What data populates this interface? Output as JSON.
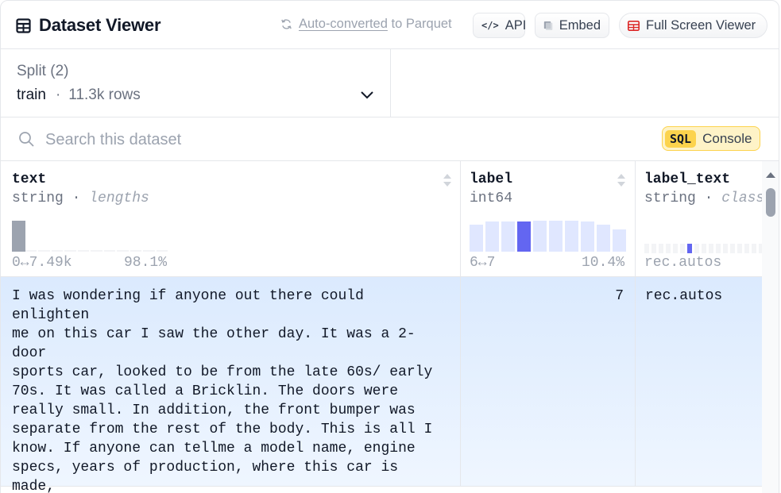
{
  "header": {
    "title": "Dataset Viewer",
    "parquet_link": "Auto-converted",
    "parquet_suffix": "to Parquet",
    "api_label": "API",
    "api_icon_glyph": "</>",
    "embed_label": "Embed",
    "full_screen_label": "Full Screen Viewer"
  },
  "split": {
    "label": "Split (2)",
    "value": "train",
    "separator": "·",
    "rows": "11.3k rows"
  },
  "search": {
    "placeholder": "Search this dataset",
    "sql_tag": "SQL",
    "sql_label": "Console"
  },
  "columns": [
    {
      "name": "text",
      "type": "string",
      "stat": "lengths",
      "range_left": "0↔7.49k",
      "range_right": "98.1%",
      "histogram_share": [
        0.98,
        0.01,
        0.005,
        0.003,
        0.002
      ]
    },
    {
      "name": "label",
      "type": "int64",
      "range_left": "6↔7",
      "range_right": "10.4%",
      "highlight_index": 3
    },
    {
      "name": "label_text",
      "type": "string",
      "stat": "classes",
      "range_left": "rec.autos"
    }
  ],
  "rows": [
    {
      "text": "I was wondering if anyone out there could enlighten\nme on this car I saw the other day. It was a 2-door\nsports car, looked to be from the late 60s/ early\n70s. It was called a Bricklin. The doors were\nreally small. In addition, the front bumper was\nseparate from the rest of the body. This is all I\nknow. If anyone can tellme a model name, engine\nspecs, years of production, where this car is made,\nhistory, or whatever info you have on this funky\nlooking car, please e-mail.",
      "label": "7",
      "label_text": "rec.autos"
    }
  ],
  "colors": {
    "accent": "#6366f1",
    "bar_light": "#e0e7ff",
    "bar_gray": "#9ca3af",
    "row_highlight": "#dbeafe",
    "sql_bg": "#fef3c7",
    "sql_tag": "#fcd34d"
  },
  "icons": {
    "title": "table-grid-icon",
    "parquet": "refresh-icon",
    "api": "code-icon",
    "embed": "embed-icon",
    "full_screen": "full-screen-table-icon",
    "split": "chevron-down-icon",
    "search": "search-icon",
    "sort": "sort-icon"
  }
}
